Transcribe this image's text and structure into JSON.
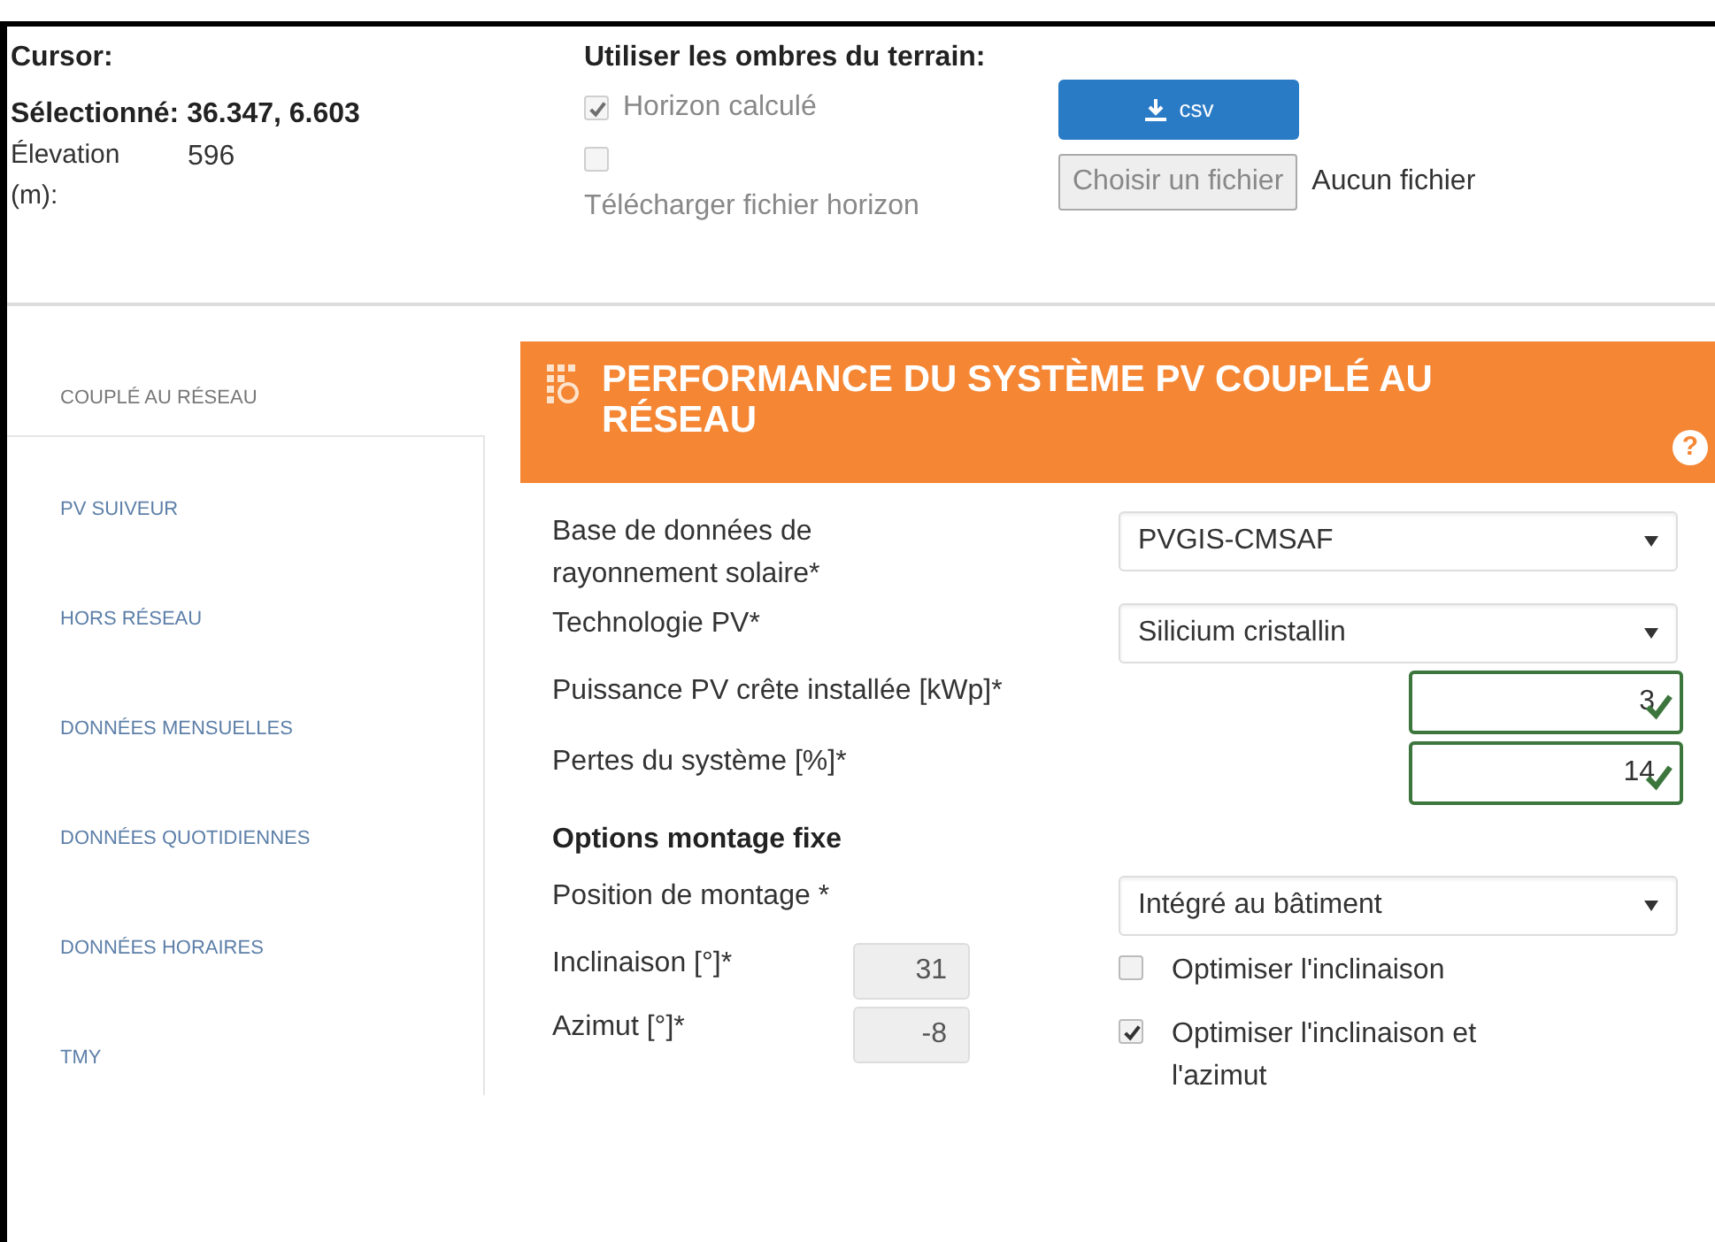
{
  "top": {
    "cursor_label": "Cursor:",
    "selected": "Sélectionné: 36.347, 6.603",
    "elevation_label": "Élevation (m):",
    "elevation_value": "596",
    "shadows": {
      "title": "Utiliser les ombres du terrain:",
      "options": [
        {
          "label": "Horizon calculé",
          "checked": true,
          "disabled": true
        },
        {
          "label": "Télécharger fichier horizon",
          "checked": false,
          "disabled": true
        }
      ]
    },
    "csv_button": "csv",
    "file_button": "Choisir un fichier",
    "file_status": "Aucun fichier"
  },
  "sidebar": {
    "items": [
      {
        "label": "COUPLÉ AU RÉSEAU",
        "selected": true
      },
      {
        "label": "PV SUIVEUR",
        "selected": false
      },
      {
        "label": "HORS RÉSEAU",
        "selected": false
      },
      {
        "label": "DONNÉES MENSUELLES",
        "selected": false
      },
      {
        "label": "DONNÉES QUOTIDIENNES",
        "selected": false
      },
      {
        "label": "DONNÉES HORAIRES",
        "selected": false
      },
      {
        "label": "TMY",
        "selected": false
      }
    ]
  },
  "panel": {
    "title": "PERFORMANCE DU SYSTÈME PV COUPLÉ AU RÉSEAU",
    "help": "?",
    "fields": [
      {
        "kind": "select",
        "label": "Base de données de rayonnement solaire*",
        "value": "PVGIS-CMSAF"
      },
      {
        "kind": "select",
        "label": "Technologie PV*",
        "value": "Silicium cristallin"
      },
      {
        "kind": "number",
        "label": "Puissance PV crête installée [kWp]*",
        "value": "3",
        "valid": true
      },
      {
        "kind": "number",
        "label": "Pertes du système [%]*",
        "value": "14",
        "valid": true
      }
    ],
    "fixed": {
      "title": "Options montage fixe",
      "position": {
        "label": "Position de montage *",
        "value": "Intégré au bâtiment"
      },
      "angles": [
        {
          "label": "Inclinaison [°]*",
          "value": "31",
          "disabled": true,
          "option": "Optimiser l'inclinaison",
          "checked": false
        },
        {
          "label": "Azimut [°]*",
          "value": "-8",
          "disabled": true,
          "option": "Optimiser l'inclinaison et l'azimut",
          "checked": true
        }
      ]
    }
  }
}
